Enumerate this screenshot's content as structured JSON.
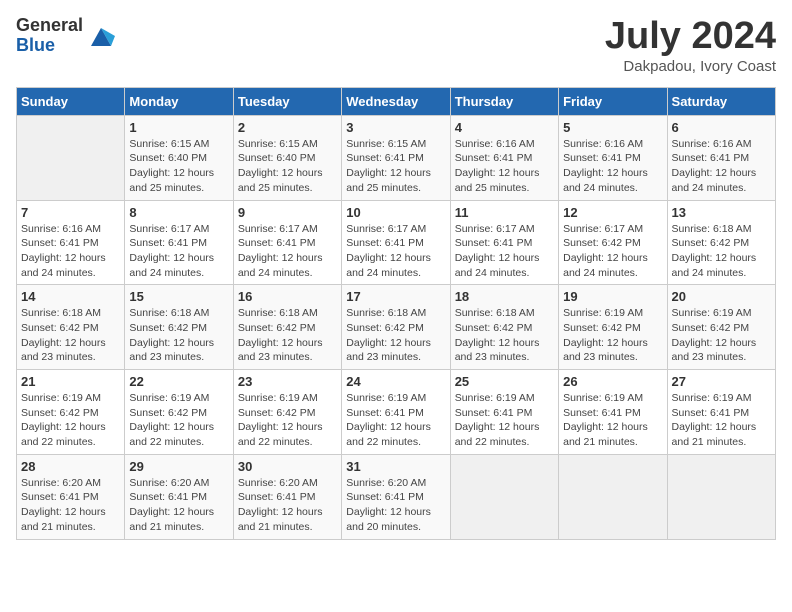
{
  "logo": {
    "general": "General",
    "blue": "Blue"
  },
  "title": "July 2024",
  "location": "Dakpadou, Ivory Coast",
  "days_header": [
    "Sunday",
    "Monday",
    "Tuesday",
    "Wednesday",
    "Thursday",
    "Friday",
    "Saturday"
  ],
  "weeks": [
    [
      {
        "day": "",
        "empty": true
      },
      {
        "day": "1",
        "sunrise": "Sunrise: 6:15 AM",
        "sunset": "Sunset: 6:40 PM",
        "daylight": "Daylight: 12 hours and 25 minutes."
      },
      {
        "day": "2",
        "sunrise": "Sunrise: 6:15 AM",
        "sunset": "Sunset: 6:40 PM",
        "daylight": "Daylight: 12 hours and 25 minutes."
      },
      {
        "day": "3",
        "sunrise": "Sunrise: 6:15 AM",
        "sunset": "Sunset: 6:41 PM",
        "daylight": "Daylight: 12 hours and 25 minutes."
      },
      {
        "day": "4",
        "sunrise": "Sunrise: 6:16 AM",
        "sunset": "Sunset: 6:41 PM",
        "daylight": "Daylight: 12 hours and 25 minutes."
      },
      {
        "day": "5",
        "sunrise": "Sunrise: 6:16 AM",
        "sunset": "Sunset: 6:41 PM",
        "daylight": "Daylight: 12 hours and 24 minutes."
      },
      {
        "day": "6",
        "sunrise": "Sunrise: 6:16 AM",
        "sunset": "Sunset: 6:41 PM",
        "daylight": "Daylight: 12 hours and 24 minutes."
      }
    ],
    [
      {
        "day": "7",
        "sunrise": "Sunrise: 6:16 AM",
        "sunset": "Sunset: 6:41 PM",
        "daylight": "Daylight: 12 hours and 24 minutes."
      },
      {
        "day": "8",
        "sunrise": "Sunrise: 6:17 AM",
        "sunset": "Sunset: 6:41 PM",
        "daylight": "Daylight: 12 hours and 24 minutes."
      },
      {
        "day": "9",
        "sunrise": "Sunrise: 6:17 AM",
        "sunset": "Sunset: 6:41 PM",
        "daylight": "Daylight: 12 hours and 24 minutes."
      },
      {
        "day": "10",
        "sunrise": "Sunrise: 6:17 AM",
        "sunset": "Sunset: 6:41 PM",
        "daylight": "Daylight: 12 hours and 24 minutes."
      },
      {
        "day": "11",
        "sunrise": "Sunrise: 6:17 AM",
        "sunset": "Sunset: 6:41 PM",
        "daylight": "Daylight: 12 hours and 24 minutes."
      },
      {
        "day": "12",
        "sunrise": "Sunrise: 6:17 AM",
        "sunset": "Sunset: 6:42 PM",
        "daylight": "Daylight: 12 hours and 24 minutes."
      },
      {
        "day": "13",
        "sunrise": "Sunrise: 6:18 AM",
        "sunset": "Sunset: 6:42 PM",
        "daylight": "Daylight: 12 hours and 24 minutes."
      }
    ],
    [
      {
        "day": "14",
        "sunrise": "Sunrise: 6:18 AM",
        "sunset": "Sunset: 6:42 PM",
        "daylight": "Daylight: 12 hours and 23 minutes."
      },
      {
        "day": "15",
        "sunrise": "Sunrise: 6:18 AM",
        "sunset": "Sunset: 6:42 PM",
        "daylight": "Daylight: 12 hours and 23 minutes."
      },
      {
        "day": "16",
        "sunrise": "Sunrise: 6:18 AM",
        "sunset": "Sunset: 6:42 PM",
        "daylight": "Daylight: 12 hours and 23 minutes."
      },
      {
        "day": "17",
        "sunrise": "Sunrise: 6:18 AM",
        "sunset": "Sunset: 6:42 PM",
        "daylight": "Daylight: 12 hours and 23 minutes."
      },
      {
        "day": "18",
        "sunrise": "Sunrise: 6:18 AM",
        "sunset": "Sunset: 6:42 PM",
        "daylight": "Daylight: 12 hours and 23 minutes."
      },
      {
        "day": "19",
        "sunrise": "Sunrise: 6:19 AM",
        "sunset": "Sunset: 6:42 PM",
        "daylight": "Daylight: 12 hours and 23 minutes."
      },
      {
        "day": "20",
        "sunrise": "Sunrise: 6:19 AM",
        "sunset": "Sunset: 6:42 PM",
        "daylight": "Daylight: 12 hours and 23 minutes."
      }
    ],
    [
      {
        "day": "21",
        "sunrise": "Sunrise: 6:19 AM",
        "sunset": "Sunset: 6:42 PM",
        "daylight": "Daylight: 12 hours and 22 minutes."
      },
      {
        "day": "22",
        "sunrise": "Sunrise: 6:19 AM",
        "sunset": "Sunset: 6:42 PM",
        "daylight": "Daylight: 12 hours and 22 minutes."
      },
      {
        "day": "23",
        "sunrise": "Sunrise: 6:19 AM",
        "sunset": "Sunset: 6:42 PM",
        "daylight": "Daylight: 12 hours and 22 minutes."
      },
      {
        "day": "24",
        "sunrise": "Sunrise: 6:19 AM",
        "sunset": "Sunset: 6:41 PM",
        "daylight": "Daylight: 12 hours and 22 minutes."
      },
      {
        "day": "25",
        "sunrise": "Sunrise: 6:19 AM",
        "sunset": "Sunset: 6:41 PM",
        "daylight": "Daylight: 12 hours and 22 minutes."
      },
      {
        "day": "26",
        "sunrise": "Sunrise: 6:19 AM",
        "sunset": "Sunset: 6:41 PM",
        "daylight": "Daylight: 12 hours and 21 minutes."
      },
      {
        "day": "27",
        "sunrise": "Sunrise: 6:19 AM",
        "sunset": "Sunset: 6:41 PM",
        "daylight": "Daylight: 12 hours and 21 minutes."
      }
    ],
    [
      {
        "day": "28",
        "sunrise": "Sunrise: 6:20 AM",
        "sunset": "Sunset: 6:41 PM",
        "daylight": "Daylight: 12 hours and 21 minutes."
      },
      {
        "day": "29",
        "sunrise": "Sunrise: 6:20 AM",
        "sunset": "Sunset: 6:41 PM",
        "daylight": "Daylight: 12 hours and 21 minutes."
      },
      {
        "day": "30",
        "sunrise": "Sunrise: 6:20 AM",
        "sunset": "Sunset: 6:41 PM",
        "daylight": "Daylight: 12 hours and 21 minutes."
      },
      {
        "day": "31",
        "sunrise": "Sunrise: 6:20 AM",
        "sunset": "Sunset: 6:41 PM",
        "daylight": "Daylight: 12 hours and 20 minutes."
      },
      {
        "day": "",
        "empty": true
      },
      {
        "day": "",
        "empty": true
      },
      {
        "day": "",
        "empty": true
      }
    ]
  ]
}
